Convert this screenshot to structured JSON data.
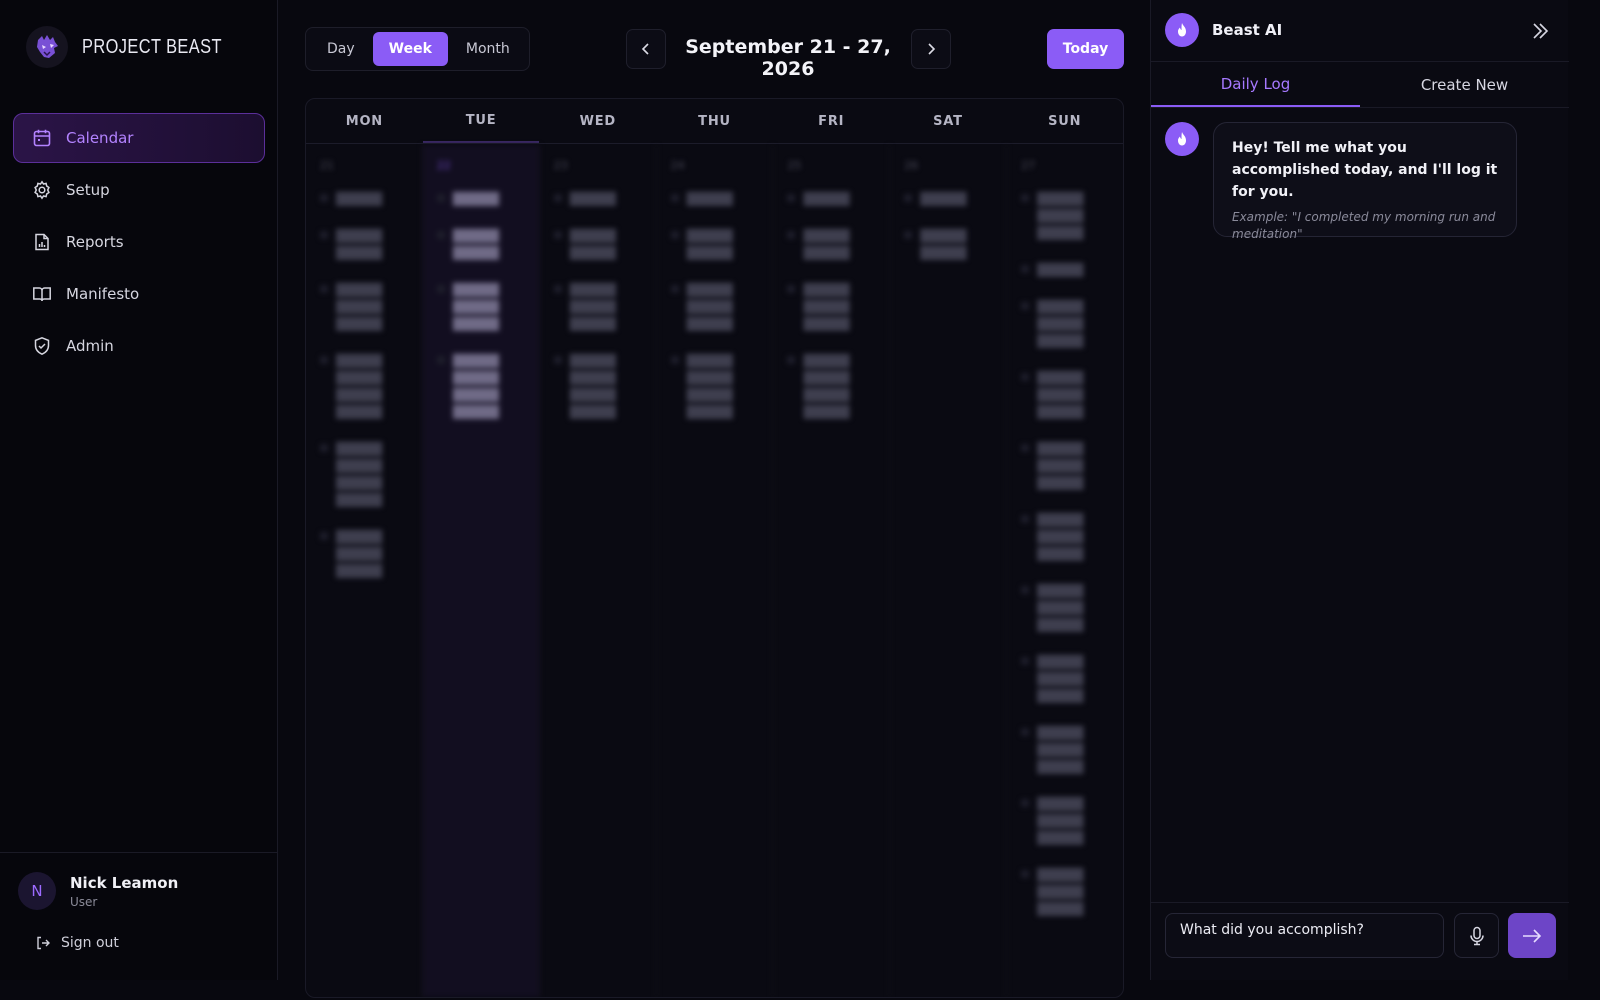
{
  "brand": {
    "name": "PROJECT BEAST"
  },
  "sidebar": {
    "items": [
      {
        "label": "Calendar",
        "icon": "calendar-icon"
      },
      {
        "label": "Setup",
        "icon": "gear-icon"
      },
      {
        "label": "Reports",
        "icon": "report-icon"
      },
      {
        "label": "Manifesto",
        "icon": "book-icon"
      },
      {
        "label": "Admin",
        "icon": "shield-icon"
      }
    ],
    "user": {
      "initial": "N",
      "name": "Nick Leamon",
      "role": "User"
    },
    "signout_label": "Sign out"
  },
  "calendar": {
    "views": [
      "Day",
      "Week",
      "Month"
    ],
    "active_view": "Week",
    "range_title": "September 21 - 27, 2026",
    "today_label": "Today",
    "days": [
      {
        "head": "MON",
        "num": "21"
      },
      {
        "head": "TUE",
        "num": "22"
      },
      {
        "head": "WED",
        "num": "23"
      },
      {
        "head": "THU",
        "num": "24"
      },
      {
        "head": "FRI",
        "num": "25"
      },
      {
        "head": "SAT",
        "num": "26"
      },
      {
        "head": "SUN",
        "num": "27"
      }
    ]
  },
  "panel": {
    "title": "Beast AI",
    "tabs": [
      "Daily Log",
      "Create New"
    ],
    "active_tab": "Daily Log",
    "message": "Hey! Tell me what you accomplished today, and I'll log it for you.",
    "example": "Example: \"I completed my morning run and meditation\"",
    "input_placeholder": "What did you accomplish?"
  },
  "colors": {
    "accent": "#8b5cf6",
    "background": "#08080f"
  }
}
